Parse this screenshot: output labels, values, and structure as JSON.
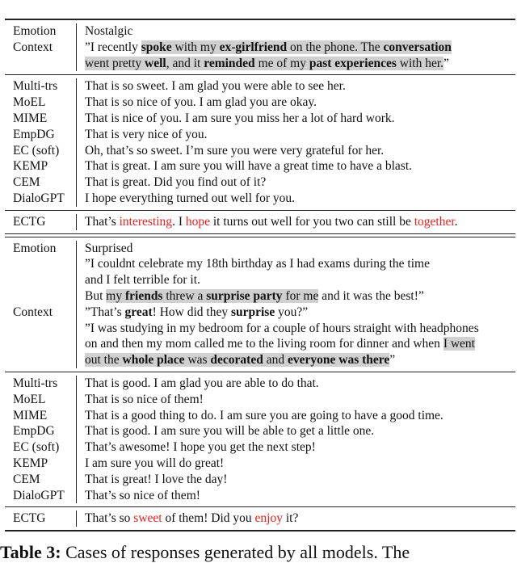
{
  "cases": [
    {
      "emotion_label": "Emotion",
      "emotion": "Nostalgic",
      "context_label": "Context",
      "context_label_line": 1,
      "context": [
        [
          {
            "t": "”I recently "
          },
          {
            "t": "spoke",
            "b": 1,
            "hl": 1
          },
          {
            "t": " with my ",
            "hl": 1
          },
          {
            "t": "ex-girlfriend",
            "b": 1,
            "hl": 1
          },
          {
            "t": " on the phone. The ",
            "hl": 1
          },
          {
            "t": "conversation",
            "b": 1,
            "hl": 1
          }
        ],
        [
          {
            "t": "went pretty ",
            "hl": 1
          },
          {
            "t": "well",
            "b": 1,
            "hl": 1
          },
          {
            "t": ", and it ",
            "hl": 1
          },
          {
            "t": "reminded",
            "b": 1,
            "hl": 1
          },
          {
            "t": " me of my ",
            "hl": 1
          },
          {
            "t": "past experiences",
            "b": 1,
            "hl": 1
          },
          {
            "t": " with her.",
            "hl": 1
          },
          {
            "t": "”"
          }
        ]
      ],
      "models": [
        {
          "name": "Multi-trs",
          "response": "That is so sweet. I am glad you were able to see her."
        },
        {
          "name": "MoEL",
          "response": "That is so nice of you. I am glad you are okay."
        },
        {
          "name": "MIME",
          "response": "That is nice of you. I am sure you miss her a lot of hard work."
        },
        {
          "name": "EmpDG",
          "response": "That is very nice of you."
        },
        {
          "name": "EC (soft)",
          "response": "Oh, that’s so sweet. I’m sure you were very grateful for her."
        },
        {
          "name": "KEMP",
          "response": "That is great. I am sure you will have a great time to have a blast."
        },
        {
          "name": "CEM",
          "response": "That is great. Did you find out of it?"
        },
        {
          "name": "DialoGPT",
          "response": "I hope everything turned out well for you."
        }
      ],
      "ours": {
        "name": "ECTG",
        "response": [
          {
            "t": "That’s "
          },
          {
            "t": "interesting",
            "red": 1
          },
          {
            "t": ". I "
          },
          {
            "t": "hope",
            "red": 1
          },
          {
            "t": " it turns out well for you two can still be "
          },
          {
            "t": "together",
            "red": 1
          },
          {
            "t": "."
          }
        ]
      }
    },
    {
      "emotion_label": "Emotion",
      "emotion": "Surprised",
      "context_label": "Context",
      "context_label_line": 4,
      "context": [
        [
          {
            "t": "”I couldnt celebrate my 18th birthday as I had exams during the time"
          }
        ],
        [
          {
            "t": "and I felt terrible for it."
          }
        ],
        [
          {
            "t": "But "
          },
          {
            "t": "my ",
            "hl": 1
          },
          {
            "t": "friends",
            "b": 1,
            "hl": 1
          },
          {
            "t": " threw a ",
            "hl": 1
          },
          {
            "t": "surprise party",
            "b": 1,
            "hl": 1
          },
          {
            "t": " for me",
            "hl": 1
          },
          {
            "t": " and it was the best!”"
          }
        ],
        [
          {
            "t": "”That’s "
          },
          {
            "t": "great",
            "b": 1
          },
          {
            "t": "! How did they "
          },
          {
            "t": "surprise",
            "b": 1
          },
          {
            "t": " you?”"
          }
        ],
        [
          {
            "t": "”I was studying in my bedroom for a couple of hours straight with headphones"
          }
        ],
        [
          {
            "t": "on and then my mom called me to the living room for dinner and when "
          },
          {
            "t": "I went",
            "hl": 1
          }
        ],
        [
          {
            "t": "out the ",
            "hl": 1
          },
          {
            "t": "whole place",
            "b": 1,
            "hl": 1
          },
          {
            "t": " was ",
            "hl": 1
          },
          {
            "t": "decorated",
            "b": 1,
            "hl": 1
          },
          {
            "t": " and ",
            "hl": 1
          },
          {
            "t": "everyone was there",
            "b": 1,
            "hl": 1
          },
          {
            "t": "”"
          }
        ]
      ],
      "models": [
        {
          "name": "Multi-trs",
          "response": "That is good. I am glad you are able to do that."
        },
        {
          "name": "MoEL",
          "response": "That is so nice of them!"
        },
        {
          "name": "MIME",
          "response": "That is a good thing to do. I am sure you are going to have a good time."
        },
        {
          "name": "EmpDG",
          "response": "That is good. I am sure you will be able to get a little one."
        },
        {
          "name": "EC (soft)",
          "response": "That’s awesome! I hope you get the next step!"
        },
        {
          "name": "KEMP",
          "response": "I am sure you will do great!"
        },
        {
          "name": "CEM",
          "response": "That is great! I love the day!"
        },
        {
          "name": "DialoGPT",
          "response": "That’s so nice of them!"
        }
      ],
      "ours": {
        "name": "ECTG",
        "response": [
          {
            "t": "That’s so "
          },
          {
            "t": "sweet",
            "red": 1
          },
          {
            "t": " of them! Did you "
          },
          {
            "t": "enjoy",
            "red": 1
          },
          {
            "t": " it?"
          }
        ]
      }
    }
  ],
  "caption": {
    "label": "Table 3:",
    "text": " Cases of responses generated by all models. The"
  },
  "colors": {
    "highlight": "#d0d0d0",
    "keyword_red": "#e8221e"
  }
}
